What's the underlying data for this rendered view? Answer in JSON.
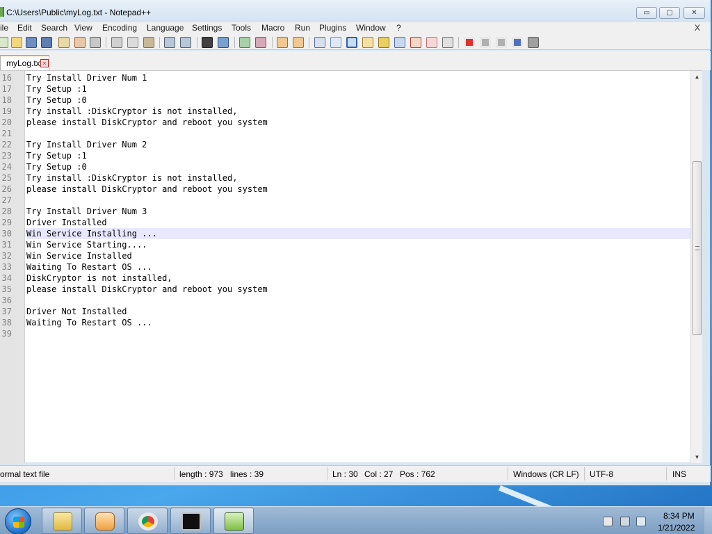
{
  "window": {
    "title": "C:\\Users\\Public\\myLog.txt - Notepad++",
    "controls": {
      "minimize": "▭",
      "maximize": "▢",
      "close": "✕"
    }
  },
  "menu": {
    "items": [
      "ile",
      "Edit",
      "Search",
      "View",
      "Encoding",
      "Language",
      "Settings",
      "Tools",
      "Macro",
      "Run",
      "Plugins",
      "Window",
      "?"
    ],
    "close_label": "X"
  },
  "toolbar": {
    "icons": [
      "new-file-icon",
      "open-file-icon",
      "save-icon",
      "save-all-icon",
      "close-icon",
      "close-all-icon",
      "print-icon",
      "cut-icon",
      "copy-icon",
      "paste-icon",
      "undo-icon",
      "redo-icon",
      "find-icon",
      "replace-icon",
      "zoom-in-icon",
      "zoom-out-icon",
      "sync-vertical-icon",
      "sync-horizontal-icon",
      "word-wrap-icon",
      "show-all-chars-icon",
      "indent-guide-icon",
      "user-language-icon",
      "doc-map-icon",
      "function-list-icon",
      "folder-workspace-icon",
      "monitoring-icon",
      "record-macro-icon",
      "stop-record-icon",
      "play-macro-icon",
      "run-macro-multiple-icon",
      "save-macro-icon"
    ]
  },
  "tab": {
    "label": "myLog.txt",
    "close": "×"
  },
  "editor": {
    "current_line": 30,
    "lines": [
      {
        "num": "16",
        "text": "Try Install Driver Num 1"
      },
      {
        "num": "17",
        "text": "Try Setup :1"
      },
      {
        "num": "18",
        "text": "Try Setup :0"
      },
      {
        "num": "19",
        "text": "Try install :DiskCryptor is not installed,"
      },
      {
        "num": "20",
        "text": "please install DiskCryptor and reboot you system"
      },
      {
        "num": "21",
        "text": ""
      },
      {
        "num": "22",
        "text": "Try Install Driver Num 2"
      },
      {
        "num": "23",
        "text": "Try Setup :1"
      },
      {
        "num": "24",
        "text": "Try Setup :0"
      },
      {
        "num": "25",
        "text": "Try install :DiskCryptor is not installed,"
      },
      {
        "num": "26",
        "text": "please install DiskCryptor and reboot you system"
      },
      {
        "num": "27",
        "text": ""
      },
      {
        "num": "28",
        "text": "Try Install Driver Num 3"
      },
      {
        "num": "29",
        "text": "Driver Installed"
      },
      {
        "num": "30",
        "text": "Win Service Installing ..."
      },
      {
        "num": "31",
        "text": "Win Service Starting...."
      },
      {
        "num": "32",
        "text": "Win Service Installed"
      },
      {
        "num": "33",
        "text": "Waiting To Restart OS ..."
      },
      {
        "num": "34",
        "text": "DiskCryptor is not installed,"
      },
      {
        "num": "35",
        "text": "please install DiskCryptor and reboot you system"
      },
      {
        "num": "36",
        "text": ""
      },
      {
        "num": "37",
        "text": "Driver Not Installed"
      },
      {
        "num": "38",
        "text": "Waiting To Restart OS ..."
      },
      {
        "num": "39",
        "text": ""
      }
    ],
    "scroll_up": "▲",
    "scroll_down": "▼"
  },
  "status": {
    "file_type": "ormal text file",
    "length": "length : 973",
    "lines": "lines : 39",
    "ln": "Ln : 30",
    "col": "Col : 27",
    "pos": "Pos : 762",
    "eol": "Windows (CR LF)",
    "encoding": "UTF-8",
    "mode": "INS"
  },
  "taskbar": {
    "apps": [
      "explorer-icon",
      "media-player-icon",
      "chrome-icon",
      "cmd-icon",
      "notepadpp-icon"
    ],
    "active_app": "notepadpp-icon",
    "tray_icons": [
      "action-center-icon",
      "network-icon",
      "volume-icon"
    ],
    "time": "8:34 PM",
    "date": "1/21/2022"
  },
  "colors": {
    "current_line_bg": "#e8e8ff",
    "tab_accent": "#f4a340",
    "desktop": "#2a8be0"
  }
}
